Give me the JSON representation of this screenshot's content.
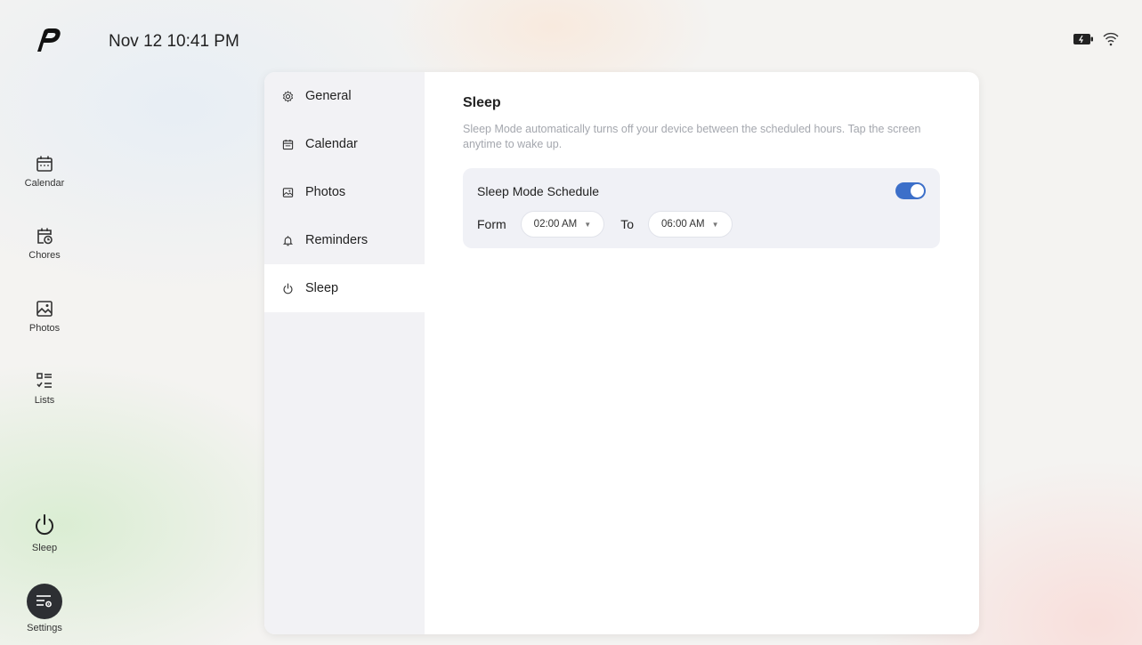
{
  "header": {
    "datetime": "Nov 12 10:41 PM"
  },
  "status_icons": [
    "battery-icon",
    "wifi-icon"
  ],
  "sidebar": {
    "items": [
      {
        "label": "Calendar",
        "icon": "calendar-icon"
      },
      {
        "label": "Chores",
        "icon": "chores-icon"
      },
      {
        "label": "Photos",
        "icon": "photos-icon"
      },
      {
        "label": "Lists",
        "icon": "lists-icon"
      },
      {
        "label": "Sleep",
        "icon": "power-icon"
      },
      {
        "label": "Settings",
        "icon": "settings-icon",
        "active": true
      }
    ]
  },
  "settings_menu": {
    "items": [
      {
        "label": "General",
        "icon": "gear-icon"
      },
      {
        "label": "Calendar",
        "icon": "calendar-icon"
      },
      {
        "label": "Photos",
        "icon": "photos-icon"
      },
      {
        "label": "Reminders",
        "icon": "bell-icon"
      },
      {
        "label": "Sleep",
        "icon": "power-icon",
        "active": true
      }
    ]
  },
  "sleep": {
    "title": "Sleep",
    "description": "Sleep Mode automatically turns off your device between the scheduled hours. Tap the screen anytime to wake up.",
    "schedule_label": "Sleep Mode Schedule",
    "schedule_enabled": true,
    "from_label": "Form",
    "from_value": "02:00 AM",
    "to_label": "To",
    "to_value": "06:00 AM"
  },
  "colors": {
    "accent": "#3c6fc9",
    "menu_bg": "#f2f2f5",
    "card_bg": "#f0f1f6",
    "settings_button": "#2d2f33"
  }
}
